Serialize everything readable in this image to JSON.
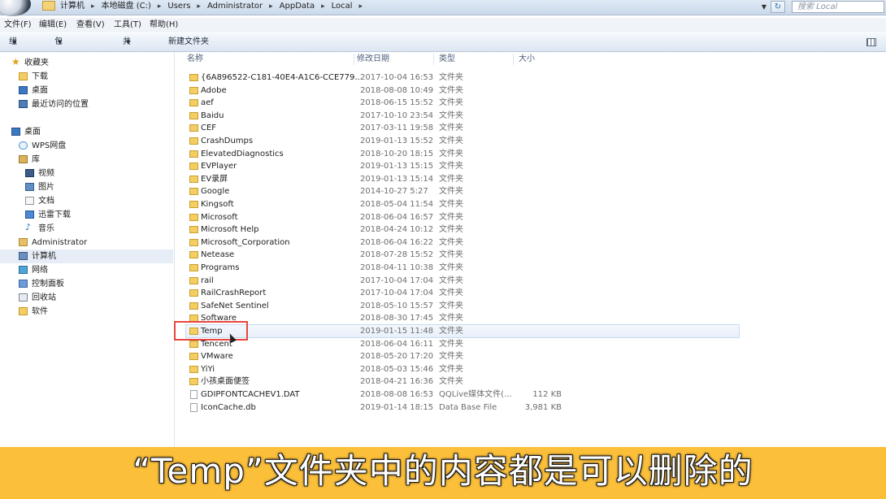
{
  "address_bar": {
    "crumbs": [
      "计算机",
      "本地磁盘 (C:)",
      "Users",
      "Administrator",
      "AppData",
      "Local"
    ],
    "search_placeholder": "搜索 Local"
  },
  "menu": [
    "文件(F)",
    "编辑(E)",
    "查看(V)",
    "工具(T)",
    "帮助(H)"
  ],
  "toolbar": {
    "organize": "组织",
    "include_library": "包含到库中",
    "share": "共享",
    "new_folder": "新建文件夹"
  },
  "nav": {
    "favorites": "收藏夹",
    "downloads": "下载",
    "desktop_fav": "桌面",
    "recent": "最近访问的位置",
    "desktop": "桌面",
    "wps": "WPS网盘",
    "library": "库",
    "videos": "视频",
    "pictures": "图片",
    "documents": "文档",
    "xunlei": "迅雷下载",
    "music": "音乐",
    "admin": "Administrator",
    "computer": "计算机",
    "network": "网络",
    "control_panel": "控制面板",
    "recycle": "回收站",
    "software": "软件"
  },
  "columns": {
    "name": "名称",
    "date": "修改日期",
    "type": "类型",
    "size": "大小"
  },
  "files": [
    {
      "name": "{6A896522-C181-40E4-A1C6-CCE779...",
      "date": "2017-10-04 16:53",
      "type": "文件夹",
      "size": ""
    },
    {
      "name": "Adobe",
      "date": "2018-08-08 10:49",
      "type": "文件夹",
      "size": ""
    },
    {
      "name": "aef",
      "date": "2018-06-15 15:52",
      "type": "文件夹",
      "size": ""
    },
    {
      "name": "Baidu",
      "date": "2017-10-10 23:54",
      "type": "文件夹",
      "size": ""
    },
    {
      "name": "CEF",
      "date": "2017-03-11 19:58",
      "type": "文件夹",
      "size": ""
    },
    {
      "name": "CrashDumps",
      "date": "2019-01-13 15:52",
      "type": "文件夹",
      "size": ""
    },
    {
      "name": "ElevatedDiagnostics",
      "date": "2018-10-20 18:15",
      "type": "文件夹",
      "size": ""
    },
    {
      "name": "EVPlayer",
      "date": "2019-01-13 15:15",
      "type": "文件夹",
      "size": ""
    },
    {
      "name": "EV录屏",
      "date": "2019-01-13 15:14",
      "type": "文件夹",
      "size": ""
    },
    {
      "name": "Google",
      "date": "2014-10-27 5:27",
      "type": "文件夹",
      "size": ""
    },
    {
      "name": "Kingsoft",
      "date": "2018-05-04 11:54",
      "type": "文件夹",
      "size": ""
    },
    {
      "name": "Microsoft",
      "date": "2018-06-04 16:57",
      "type": "文件夹",
      "size": ""
    },
    {
      "name": "Microsoft Help",
      "date": "2018-04-24 10:12",
      "type": "文件夹",
      "size": ""
    },
    {
      "name": "Microsoft_Corporation",
      "date": "2018-06-04 16:22",
      "type": "文件夹",
      "size": ""
    },
    {
      "name": "Netease",
      "date": "2018-07-28 15:52",
      "type": "文件夹",
      "size": ""
    },
    {
      "name": "Programs",
      "date": "2018-04-11 10:38",
      "type": "文件夹",
      "size": ""
    },
    {
      "name": "rail",
      "date": "2017-10-04 17:04",
      "type": "文件夹",
      "size": ""
    },
    {
      "name": "RailCrashReport",
      "date": "2017-10-04 17:04",
      "type": "文件夹",
      "size": ""
    },
    {
      "name": "SafeNet Sentinel",
      "date": "2018-05-10 15:57",
      "type": "文件夹",
      "size": ""
    },
    {
      "name": "Software",
      "date": "2018-08-30 17:45",
      "type": "文件夹",
      "size": ""
    },
    {
      "name": "Temp",
      "date": "2019-01-15 11:48",
      "type": "文件夹",
      "size": ""
    },
    {
      "name": "Tencent",
      "date": "2018-06-04 16:11",
      "type": "文件夹",
      "size": ""
    },
    {
      "name": "VMware",
      "date": "2018-05-20 17:20",
      "type": "文件夹",
      "size": ""
    },
    {
      "name": "YiYi",
      "date": "2018-05-03 15:46",
      "type": "文件夹",
      "size": ""
    },
    {
      "name": "小孩桌面便签",
      "date": "2018-04-21 16:36",
      "type": "文件夹",
      "size": ""
    },
    {
      "name": "GDIPFONTCACHEV1.DAT",
      "date": "2018-08-08 16:53",
      "type": "QQLive媒体文件(...",
      "size": "112 KB"
    },
    {
      "name": "IconCache.db",
      "date": "2019-01-14 18:15",
      "type": "Data Base File",
      "size": "3,981 KB"
    }
  ],
  "subtitle": "“Temp”文件夹中的内容都是可以删除的"
}
